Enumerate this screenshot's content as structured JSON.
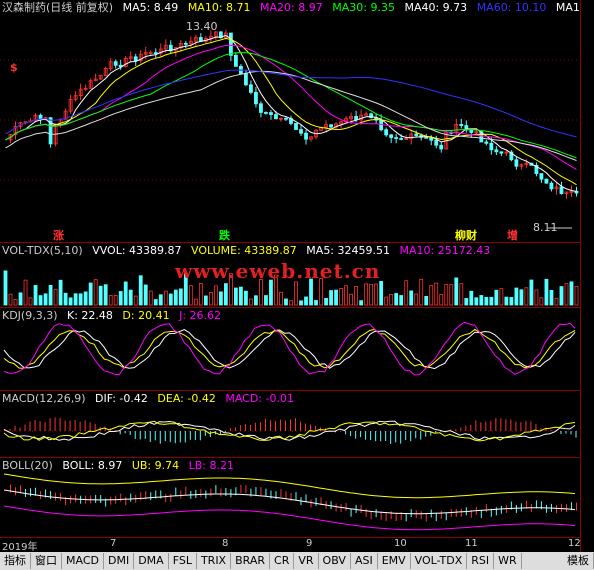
{
  "colors": {
    "ma5": "#ffffff",
    "ma10": "#ffff00",
    "ma20": "#ff00ff",
    "ma30": "#00ff00",
    "ma40": "#ffffff",
    "ma60": "#0000ff",
    "up": "#ff3232",
    "down": "#54ffff",
    "frame": "#8b0000"
  },
  "main": {
    "title": "汉森制药(日线 前复权)",
    "diamond": "◇",
    "ma5": "MA5: 8.49",
    "ma10": "MA10: 8.71",
    "ma20": "MA20: 8.97",
    "ma30": "MA30: 9.35",
    "ma40": "MA40: 9.73",
    "ma60": "MA60: 10.10",
    "ma1": "MA1",
    "high_label": "13.40",
    "low_label": "8.11",
    "marks": {
      "m1": "$",
      "m2": "涨",
      "m3": "跌",
      "m4": "柳财",
      "m5": "增"
    }
  },
  "vol": {
    "name": "VOL-TDX(5,10)",
    "vvol": "VVOL: 43389.87",
    "volume": "VOLUME: 43389.87",
    "ma5": "MA5: 32459.51",
    "ma10": "MA10: 25172.43"
  },
  "watermark": "www.eweb.net.cn",
  "kdj": {
    "name": "KDJ(9,3,3)",
    "k": "K: 22.48",
    "d": "D: 20.41",
    "j": "J: 26.62"
  },
  "macd": {
    "name": "MACD(12,26,9)",
    "dif": "DIF: -0.42",
    "dea": "DEA: -0.42",
    "macd": "MACD: -0.01"
  },
  "boll": {
    "name": "BOLL(20)",
    "boll": "BOLL: 8.97",
    "ub": "UB: 9.74",
    "lb": "LB: 8.21"
  },
  "dates": {
    "d1": "2019年",
    "d2": "7",
    "d3": "8",
    "d4": "9",
    "d5": "10",
    "d6": "11",
    "d7": "12"
  },
  "tabs": [
    "指标",
    "窗口",
    "MACD",
    "DMI",
    "DMA",
    "FSL",
    "TRIX",
    "BRAR",
    "CR",
    "VR",
    "OBV",
    "ASI",
    "EMV",
    "VOL-TDX",
    "RSI",
    "WR",
    "模板"
  ]
}
